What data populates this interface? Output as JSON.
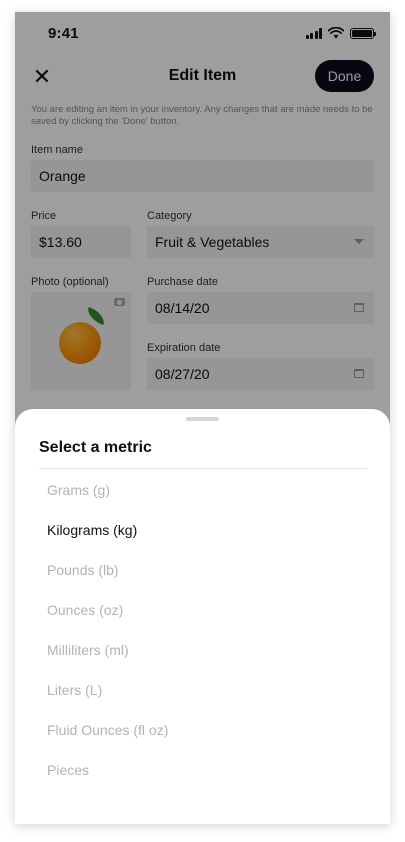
{
  "status_bar": {
    "time": "9:41"
  },
  "nav": {
    "title": "Edit Item",
    "done_label": "Done",
    "close_symbol": "✕"
  },
  "intro_text": "You are editing an item in your inventory. Any changes that are made needs to be saved by clicking the 'Done' button.",
  "form": {
    "item_name": {
      "label": "Item name",
      "value": "Orange"
    },
    "price": {
      "label": "Price",
      "value": "$13.60"
    },
    "category": {
      "label": "Category",
      "value": "Fruit & Vegetables"
    },
    "photo": {
      "label": "Photo (optional)"
    },
    "purchase_date": {
      "label": "Purchase date",
      "value": "08/14/20"
    },
    "expiration_date": {
      "label": "Expiration date",
      "value": "08/27/20"
    }
  },
  "sheet": {
    "title": "Select a metric",
    "options": [
      {
        "label": "Grams (g)",
        "selected": false
      },
      {
        "label": "Kilograms (kg)",
        "selected": true
      },
      {
        "label": "Pounds (lb)",
        "selected": false
      },
      {
        "label": "Ounces (oz)",
        "selected": false
      },
      {
        "label": "Milliliters (ml)",
        "selected": false
      },
      {
        "label": "Liters (L)",
        "selected": false
      },
      {
        "label": "Fluid Ounces (fl oz)",
        "selected": false
      },
      {
        "label": "Pieces",
        "selected": false
      }
    ]
  },
  "colors": {
    "primary_button": "#0c0c1e",
    "field_background": "#f2f2f2",
    "muted_text": "#b3b3b3",
    "selected_text": "#111111"
  },
  "icons": [
    "signal-icon",
    "wifi-icon",
    "battery-icon",
    "close-icon",
    "dropdown-caret-icon",
    "camera-icon",
    "calendar-icon"
  ]
}
